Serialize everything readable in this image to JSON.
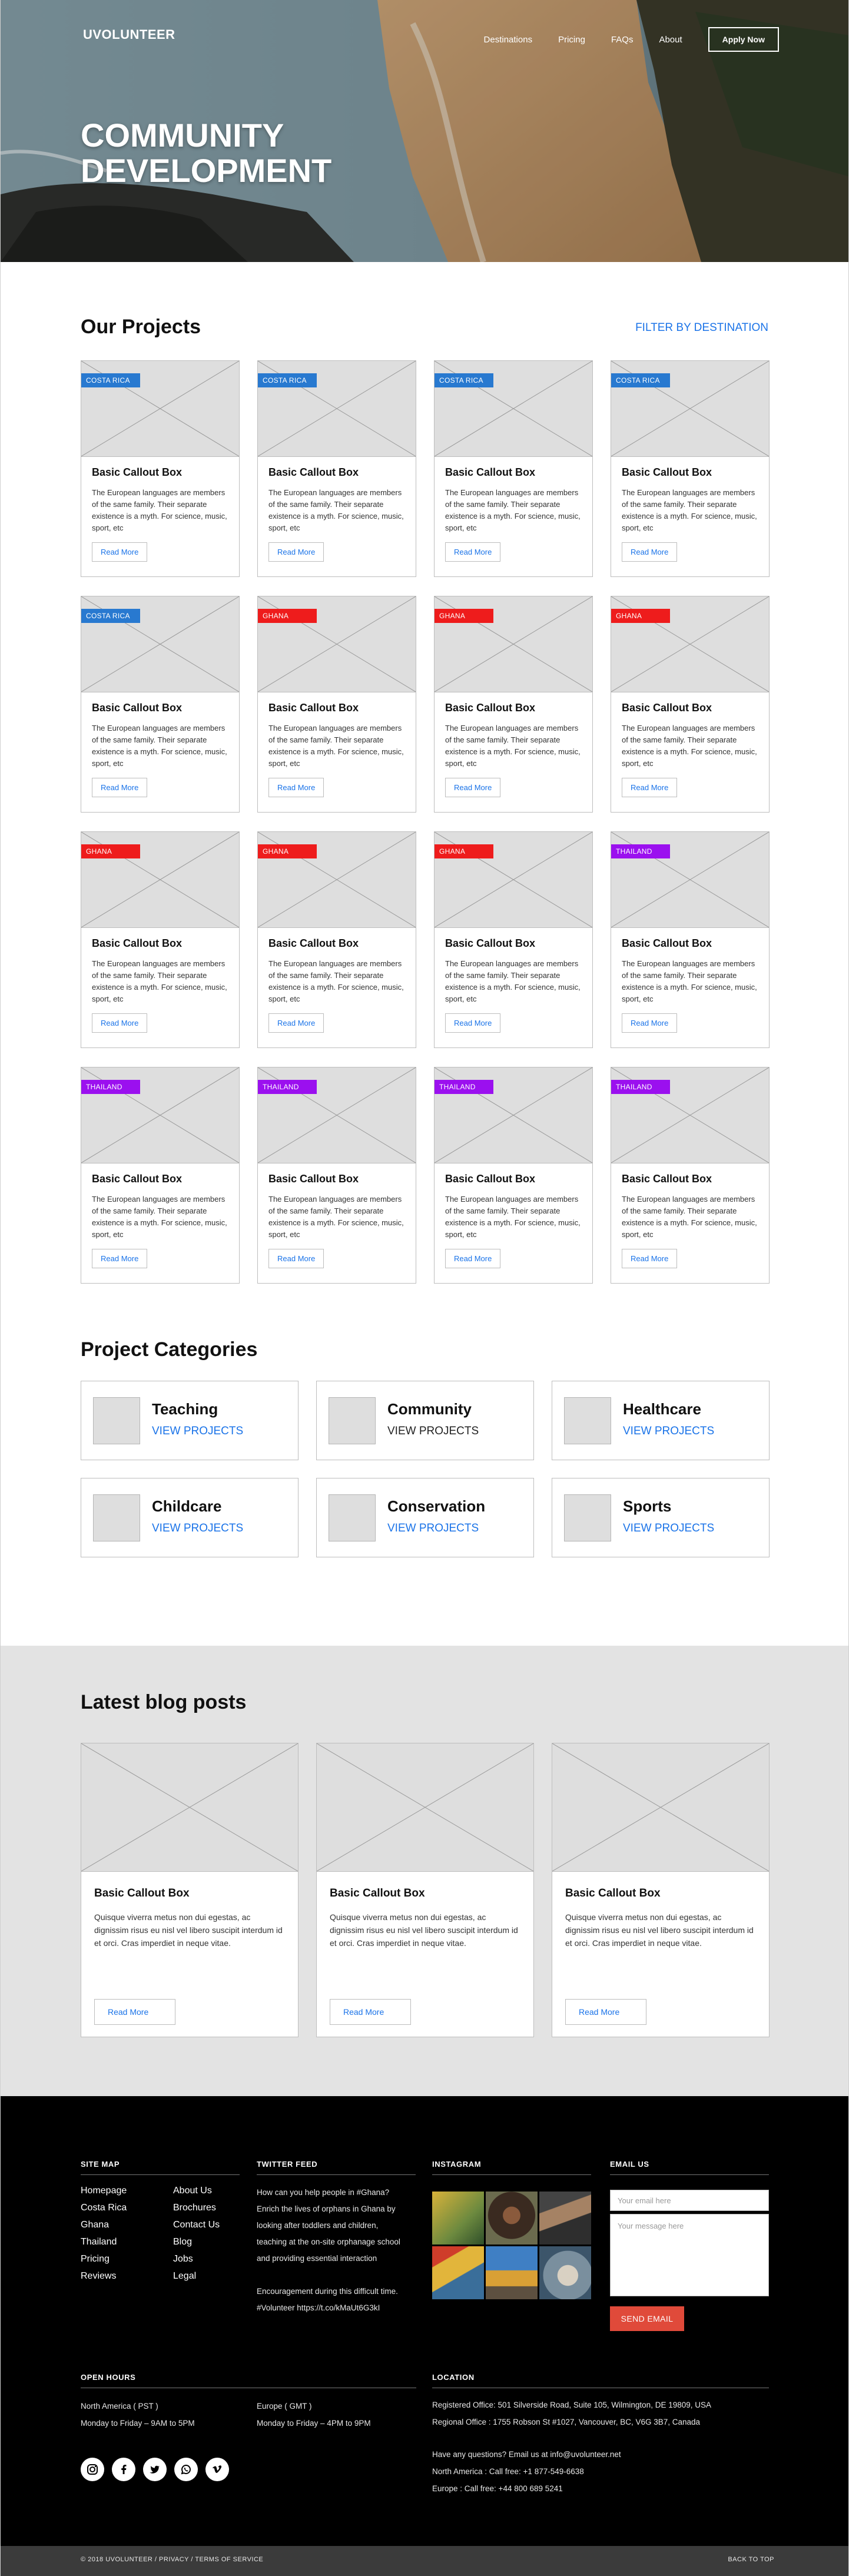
{
  "colors": {
    "accent": "#1a73e8",
    "tag_costa_rica": "#2879d0",
    "tag_ghana": "#ee1c1c",
    "tag_thailand": "#9b10ef",
    "send_button": "#e04a3a",
    "footer_bg": "#000000",
    "blog_band_bg": "#e3e3e3"
  },
  "header": {
    "brand": "UVOLUNTEER",
    "nav": [
      "Destinations",
      "Pricing",
      "FAQs",
      "About"
    ],
    "apply_label": "Apply Now"
  },
  "hero": {
    "title_line1": "COMMUNITY",
    "title_line2": "DEVELOPMENT"
  },
  "projects": {
    "title": "Our Projects",
    "filter_label": "FILTER BY DESTINATION",
    "card_title": "Basic Callout Box",
    "card_text": "The European languages are members of the same family. Their separate existence is a myth. For science, music, sport, etc",
    "card_button": "Read More",
    "tags": [
      "COSTA RICA",
      "COSTA RICA",
      "COSTA RICA",
      "COSTA RICA",
      "COSTA RICA",
      "GHANA",
      "GHANA",
      "GHANA",
      "GHANA",
      "GHANA",
      "GHANA",
      "THAILAND",
      "THAILAND",
      "THAILAND",
      "THAILAND",
      "THAILAND"
    ]
  },
  "categories": {
    "title": "Project Categories",
    "items": [
      {
        "name": "Teaching",
        "link": "VIEW PROJECTS"
      },
      {
        "name": "Community",
        "link": "VIEW PROJECTS"
      },
      {
        "name": "Healthcare",
        "link": "VIEW PROJECTS"
      },
      {
        "name": "Childcare",
        "link": "VIEW PROJECTS"
      },
      {
        "name": "Conservation",
        "link": "VIEW PROJECTS"
      },
      {
        "name": "Sports",
        "link": "VIEW PROJECTS"
      }
    ]
  },
  "blog": {
    "title": "Latest blog posts",
    "card_title": "Basic Callout Box",
    "card_text": "Quisque viverra metus non dui egestas, ac dignissim risus eu nisl vel libero suscipit interdum id et orci. Cras imperdiet in neque vitae.",
    "card_button": "Read More"
  },
  "footer": {
    "sitemap_heading": "SITE MAP",
    "sitemap_col1": [
      "Homepage",
      "Costa Rica",
      "Ghana",
      "Thailand",
      "Pricing",
      "Reviews"
    ],
    "sitemap_col2": [
      "About Us",
      "Brochures",
      "Contact Us",
      "Blog",
      "Jobs",
      "Legal"
    ],
    "twitter_heading": "TWITTER FEED",
    "twitter_lines": [
      "How can you help people in #Ghana?",
      "Enrich the lives of orphans in Ghana by",
      "looking after toddlers and children,",
      "teaching at the on-site orphanage school",
      "and providing essential interaction"
    ],
    "twitter_lines2": [
      "Encouragement during this difficult time.",
      "#Volunteer https://t.co/kMaUt6G3kI"
    ],
    "instagram_heading": "INSTAGRAM",
    "email_heading": "EMAIL US",
    "email_placeholder": "Your email here",
    "message_placeholder": "Your message here",
    "send_label": "SEND EMAIL",
    "hours_heading": "OPEN HOURS",
    "hours_na_region": "North America ( PST )",
    "hours_na_time": "Monday to Friday – 9AM to 5PM",
    "hours_eu_region": "Europe ( GMT )",
    "hours_eu_time": "Monday to Friday – 4PM to 9PM",
    "location_heading": "LOCATION",
    "registered_office": "Registered Office: 501 Silverside Road, Suite 105, Wilmington, DE 19809, USA",
    "regional_office": "Regional Office : 1755 Robson St #1027, Vancouver, BC, V6G 3B7, Canada",
    "questions": "Have any questions? Email us at info@uvolunteer.net",
    "phone_na": "North America : Call free: +1 877-549-6638",
    "phone_eu": "Europe : Call free: +44 800 689 5241",
    "social_icons": [
      "instagram-icon",
      "facebook-icon",
      "twitter-icon",
      "whatsapp-icon",
      "vimeo-icon"
    ],
    "copyright": "© 2018 UVOLUNTEER / PRIVACY / TERMS OF SERVICE",
    "back_to_top": "BACK TO TOP"
  }
}
